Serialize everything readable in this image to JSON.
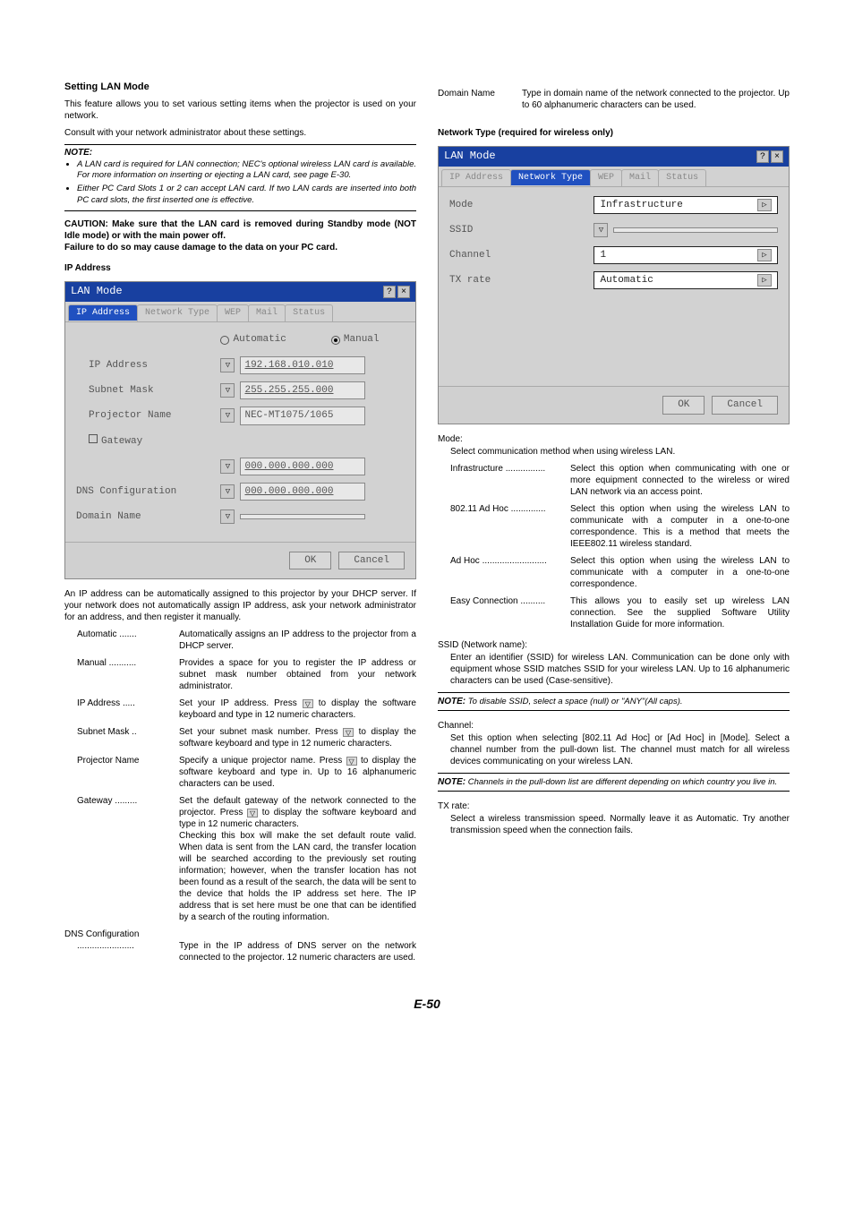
{
  "left": {
    "heading": "Setting LAN Mode",
    "intro1": "This feature allows you to set various setting items when the projector is used on your network.",
    "intro2": "Consult with your network administrator about these settings.",
    "note_label": "NOTE:",
    "note_items": [
      "A LAN card is required for LAN connection; NEC's optional wireless LAN card is available. For more information on inserting or ejecting a LAN card, see page E-30.",
      "Either PC Card Slots 1 or 2 can accept LAN card. If two LAN cards are inserted into both PC card slots, the first inserted one is effective."
    ],
    "caution1": "CAUTION: Make sure that the LAN card is removed during Standby mode (NOT Idle mode) or with the main power off.",
    "caution2": "Failure to do so may cause damage to the data on your PC card.",
    "ip_heading": "IP Address",
    "dialog1": {
      "title": "LAN Mode",
      "tabs": [
        "IP Address",
        "Network Type",
        "WEP",
        "Mail",
        "Status"
      ],
      "radio_auto": "Automatic",
      "radio_manual": "Manual",
      "rows": {
        "ip_addr_lbl": "IP Address",
        "ip_addr_val": "192.168.010.010",
        "subnet_lbl": "Subnet Mask",
        "subnet_val": "255.255.255.000",
        "proj_lbl": "Projector Name",
        "proj_val": "NEC-MT1075/1065",
        "gateway_lbl": "Gateway",
        "gateway_val": "000.000.000.000",
        "dns_lbl": "DNS Configuration",
        "dns_val": "000.000.000.000",
        "domain_lbl": "Domain Name",
        "domain_val": ""
      },
      "ok": "OK",
      "cancel": "Cancel"
    },
    "ip_para": "An IP address can be automatically assigned to this projector by your DHCP server. If your network does not automatically assign IP address, ask your network administrator for an address, and then register it manually.",
    "defs": [
      {
        "term": "Automatic",
        "dots": ".......",
        "desc": "Automatically assigns an IP address to the projector from a DHCP server."
      },
      {
        "term": "Manual",
        "dots": "...........",
        "desc": "Provides a space for you to register the IP address or subnet mask number obtained from your network administrator."
      },
      {
        "term": "IP Address",
        "dots": ".....",
        "desc": "Set your IP address. Press ▽ to display the software keyboard and type in 12 numeric characters."
      },
      {
        "term": "Subnet Mask",
        "dots": "..",
        "desc": "Set your subnet mask number. Press ▽ to display the software keyboard and type in 12 numeric characters."
      },
      {
        "term": "Projector Name",
        "dots": "",
        "desc": "Specify a unique projector name. Press ▽ to display the software keyboard and type in. Up to 16 alphanumeric characters can be used."
      },
      {
        "term": "Gateway",
        "dots": ".........",
        "desc": "Set the default gateway of the network connected to the projector. Press ▽ to display the software keyboard and type in 12 numeric characters.\nChecking this box will make the set default route valid. When data is sent from the LAN card, the transfer location will be searched according to the previously set routing information; however, when the transfer location has not been found as a result of the search, the data will be sent to the device that holds the IP address set here. The IP address that is set here must be one that can be identified by a search of the routing information."
      }
    ],
    "dns_conf_label": "DNS Configuration",
    "dns_conf_desc": "Type in the IP address of DNS server on the network connected to the projector. 12 numeric characters are used.",
    "dns_conf_dots": "......................."
  },
  "right": {
    "domain_def_term": "Domain Name",
    "domain_def_desc": "Type in domain name of the network connected to the projector. Up to 60 alphanumeric characters can be used.",
    "nt_heading": "Network Type (required for wireless only)",
    "dialog2": {
      "title": "LAN Mode",
      "tabs": [
        "IP Address",
        "Network Type",
        "WEP",
        "Mail",
        "Status"
      ],
      "mode_lbl": "Mode",
      "mode_val": "Infrastructure",
      "ssid_lbl": "SSID",
      "ssid_val": "",
      "channel_lbl": "Channel",
      "channel_val": "1",
      "tx_lbl": "TX rate",
      "tx_val": "Automatic",
      "ok": "OK",
      "cancel": "Cancel"
    },
    "mode_hdr": "Mode:",
    "mode_para": "Select communication method when using wireless LAN.",
    "mode_defs": [
      {
        "term": "Infrastructure",
        "dots": "................",
        "desc": "Select this option when communicating with one or more equipment connected to the wireless or wired LAN network via an access point."
      },
      {
        "term": "802.11 Ad Hoc",
        "dots": "..............",
        "desc": "Select this option when using the wireless LAN to communicate with a computer in a one-to-one correspondence. This is a method that meets the IEEE802.11 wireless standard."
      },
      {
        "term": "Ad Hoc",
        "dots": "..........................",
        "desc": "Select this option when using the wireless LAN to communicate with a computer in a one-to-one correspondence."
      },
      {
        "term": "Easy Connection",
        "dots": "..........",
        "desc": "This allows you to easily set up wireless LAN connection. See the supplied Software Utility Installation Guide for more information."
      }
    ],
    "ssid_hdr": "SSID (Network name):",
    "ssid_para": "Enter an identifier (SSID) for wireless LAN. Communication can be done only with equipment whose SSID matches SSID for your wireless LAN. Up to 16 alphanumeric characters can be used (Case-sensitive).",
    "ssid_note_prefix": "NOTE:",
    "ssid_note": " To disable SSID, select a space (null) or \"ANY\"(All caps).",
    "channel_hdr": "Channel:",
    "channel_para": "Set this option when selecting [802.11 Ad Hoc] or [Ad Hoc] in [Mode]. Select a channel number from the pull-down list. The channel must match for all wireless devices communicating on your wireless LAN.",
    "channel_note_prefix": "NOTE:",
    "channel_note": " Channels in the pull-down list are different depending on which country you live in.",
    "tx_hdr": "TX rate:",
    "tx_para": "Select a wireless transmission speed. Normally leave it as Automatic. Try another transmission speed when the connection fails."
  },
  "page": "E-50"
}
